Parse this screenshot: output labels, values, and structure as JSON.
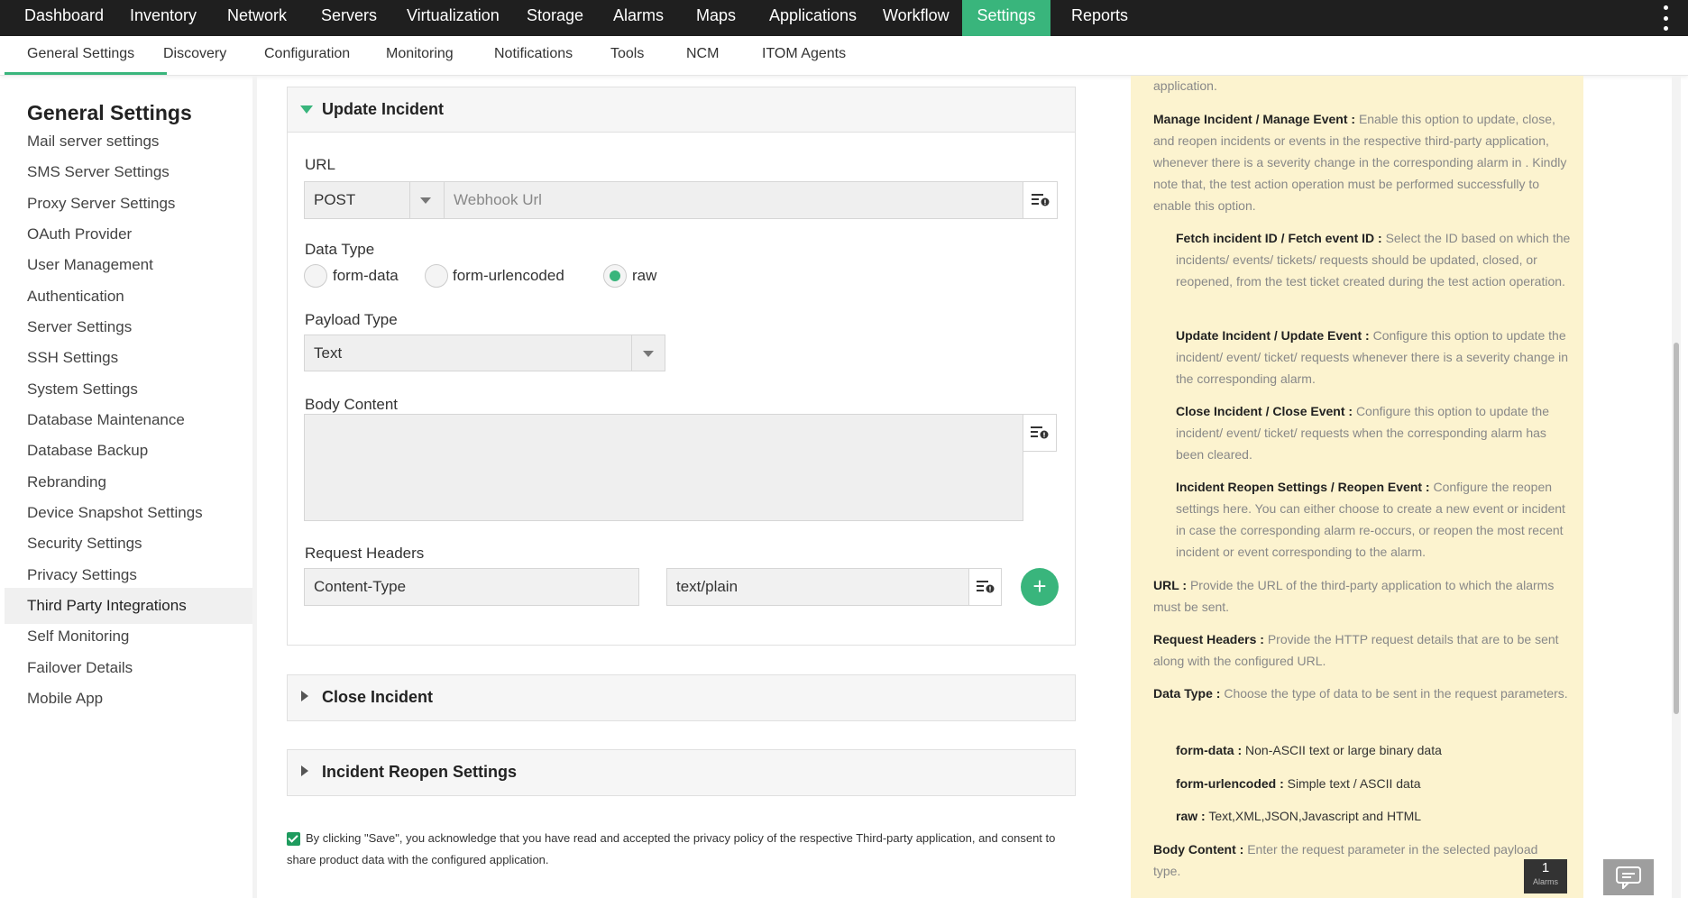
{
  "topnav": {
    "items": [
      "Dashboard",
      "Inventory",
      "Network",
      "Servers",
      "Virtualization",
      "Storage",
      "Alarms",
      "Maps",
      "Applications",
      "Workflow",
      "Settings",
      "Reports"
    ],
    "active": "Settings"
  },
  "subnav": {
    "items": [
      "General Settings",
      "Discovery",
      "Configuration",
      "Monitoring",
      "Notifications",
      "Tools",
      "NCM",
      "ITOM Agents"
    ],
    "active": "General Settings"
  },
  "sidebar": {
    "title": "General Settings",
    "items": [
      "Mail server settings",
      "SMS Server Settings",
      "Proxy Server Settings",
      "OAuth Provider",
      "User Management",
      "Authentication",
      "Server Settings",
      "SSH Settings",
      "System Settings",
      "Database Maintenance",
      "Database Backup",
      "Rebranding",
      "Device Snapshot Settings",
      "Security Settings",
      "Privacy Settings",
      "Third Party Integrations",
      "Self Monitoring",
      "Failover Details",
      "Mobile App"
    ],
    "active": "Third Party Integrations"
  },
  "update_incident": {
    "title": "Update Incident",
    "url_label": "URL",
    "method": "POST",
    "url_placeholder": "Webhook Url",
    "data_type_label": "Data Type",
    "data_types": [
      "form-data",
      "form-urlencoded",
      "raw"
    ],
    "data_type_selected": "raw",
    "payload_label": "Payload Type",
    "payload_value": "Text",
    "body_label": "Body Content",
    "body_value": "",
    "headers_label": "Request Headers",
    "header_key": "Content-Type",
    "header_value": "text/plain",
    "add_symbol": "+"
  },
  "close_incident": {
    "title": "Close Incident"
  },
  "reopen": {
    "title": "Incident Reopen Settings"
  },
  "consent": {
    "checked": true,
    "text": "By clicking \"Save\", you acknowledge that you have read and accepted the privacy policy of the respective Third-party application, and consent to share product data with the configured application."
  },
  "help": {
    "top_fragment": "application.",
    "manage_title": "Manage Incident / Manage Event :",
    "manage_text": "Enable this option to update, close, and reopen incidents or events in the respective third-party application, whenever there is a severity change in the corresponding alarm in . Kindly note that, the test action operation must be performed successfully to enable this option.",
    "fetch_title": "Fetch incident ID / Fetch event ID :",
    "fetch_text": "Select the ID based on which the incidents/ events/ tickets/ requests should be updated, closed, or reopened, from the test ticket created during the test action operation.",
    "update_title": "Update Incident / Update Event :",
    "update_text": "Configure this option to update the incident/ event/ ticket/ requests whenever there is a severity change in the corresponding alarm.",
    "close_title": "Close Incident / Close Event :",
    "close_text": "Configure this option to update the incident/ event/ ticket/ requests when the corresponding alarm has been cleared.",
    "reopen_title": "Incident Reopen Settings / Reopen Event :",
    "reopen_text": "Configure the reopen settings here. You can either choose to create a new event or incident in case the corresponding alarm re-occurs, or reopen the most recent incident or event corresponding to the alarm.",
    "url_title": "URL :",
    "url_text": "Provide the URL of the third-party application to which the alarms must be sent.",
    "headers_title": "Request Headers :",
    "headers_text": "Provide the HTTP request details that are to be sent along with the configured URL.",
    "datatype_title": "Data Type :",
    "datatype_text": "Choose the type of data to be sent in the request parameters.",
    "fd_title": "form-data :",
    "fd_text": "Non-ASCII text or large binary data",
    "fu_title": "form-urlencoded :",
    "fu_text": "Simple text / ASCII data",
    "raw_title": "raw :",
    "raw_text": "Text,XML,JSON,Javascript and HTML",
    "body_title": "Body Content :",
    "body_text": "Enter the request parameter in the selected payload type."
  },
  "alarms_widget": {
    "count": "1",
    "label": "Alarms"
  },
  "colors": {
    "accent": "#39b57c",
    "topbar": "#1f1f1f",
    "help_bg": "#fcf3cf"
  }
}
